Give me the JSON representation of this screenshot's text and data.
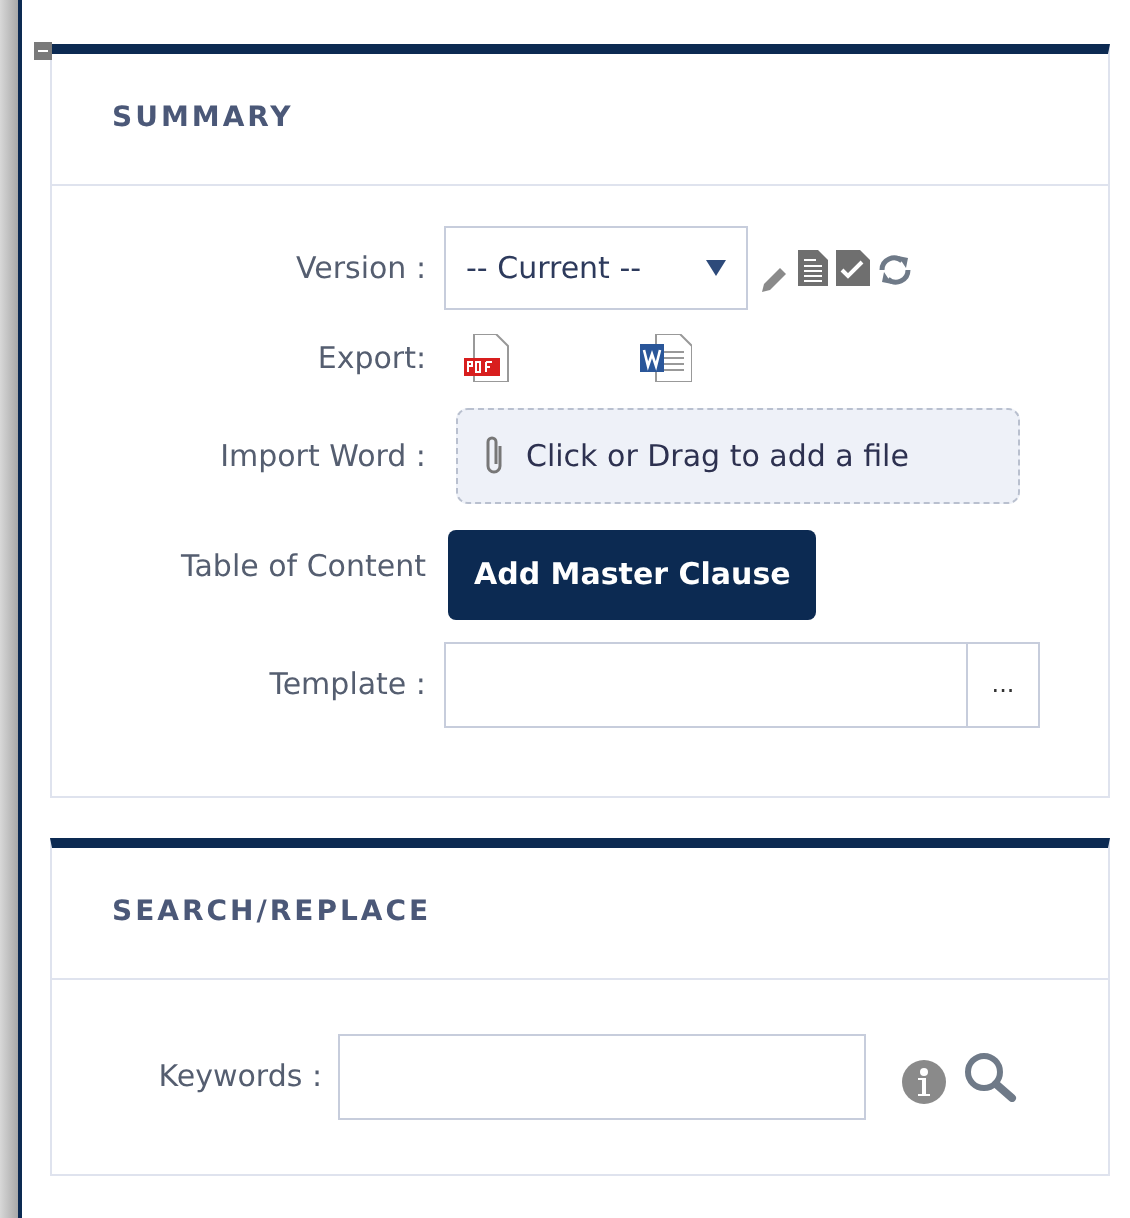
{
  "summary": {
    "title": "SUMMARY",
    "version": {
      "label": "Version :",
      "value": "-- Current --"
    },
    "export": {
      "label": "Export:"
    },
    "import_word": {
      "label": "Import Word :",
      "dropzone": "Click or Drag to add a file"
    },
    "table_of_content": {
      "label": "Table of Content",
      "button": "Add Master Clause"
    },
    "template": {
      "label": "Template :",
      "browse": "..."
    }
  },
  "search_replace": {
    "title": "SEARCH/REPLACE",
    "keywords": {
      "label": "Keywords :"
    }
  }
}
